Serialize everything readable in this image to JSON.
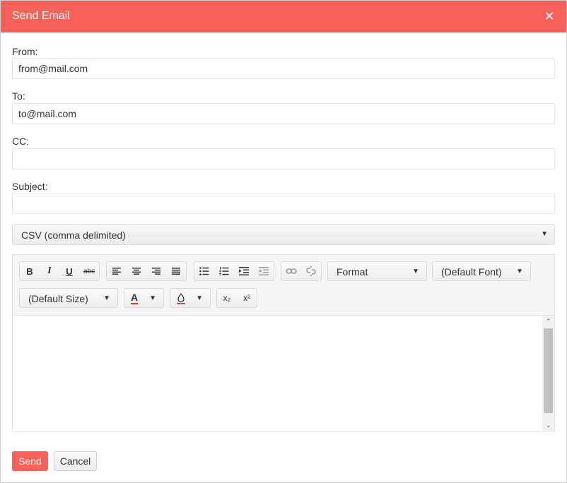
{
  "dialog": {
    "title": "Send Email",
    "close_glyph": "✕"
  },
  "form": {
    "from": {
      "label": "From:",
      "value": "from@mail.com"
    },
    "to": {
      "label": "To:",
      "value": "to@mail.com"
    },
    "cc": {
      "label": "CC:",
      "value": ""
    },
    "subject": {
      "label": "Subject:",
      "value": ""
    },
    "format_select": {
      "value": "CSV (comma delimited)"
    }
  },
  "toolbar": {
    "bold": "B",
    "italic": "I",
    "underline": "U",
    "strikethrough": "abc",
    "format_dropdown": "Format",
    "font_dropdown": "(Default Font)",
    "size_dropdown": "(Default Size)",
    "font_color_glyph": "A",
    "subscript": "x₂",
    "superscript": "x²",
    "dropdown_arrow": "▼"
  },
  "editor": {
    "scroll_up": "⌃",
    "scroll_down": "⌄"
  },
  "buttons": {
    "send": "Send",
    "cancel": "Cancel"
  },
  "colors": {
    "accent": "#f9605a",
    "toolbar_bg": "#f5f5f5",
    "border": "#e4e4e4"
  }
}
